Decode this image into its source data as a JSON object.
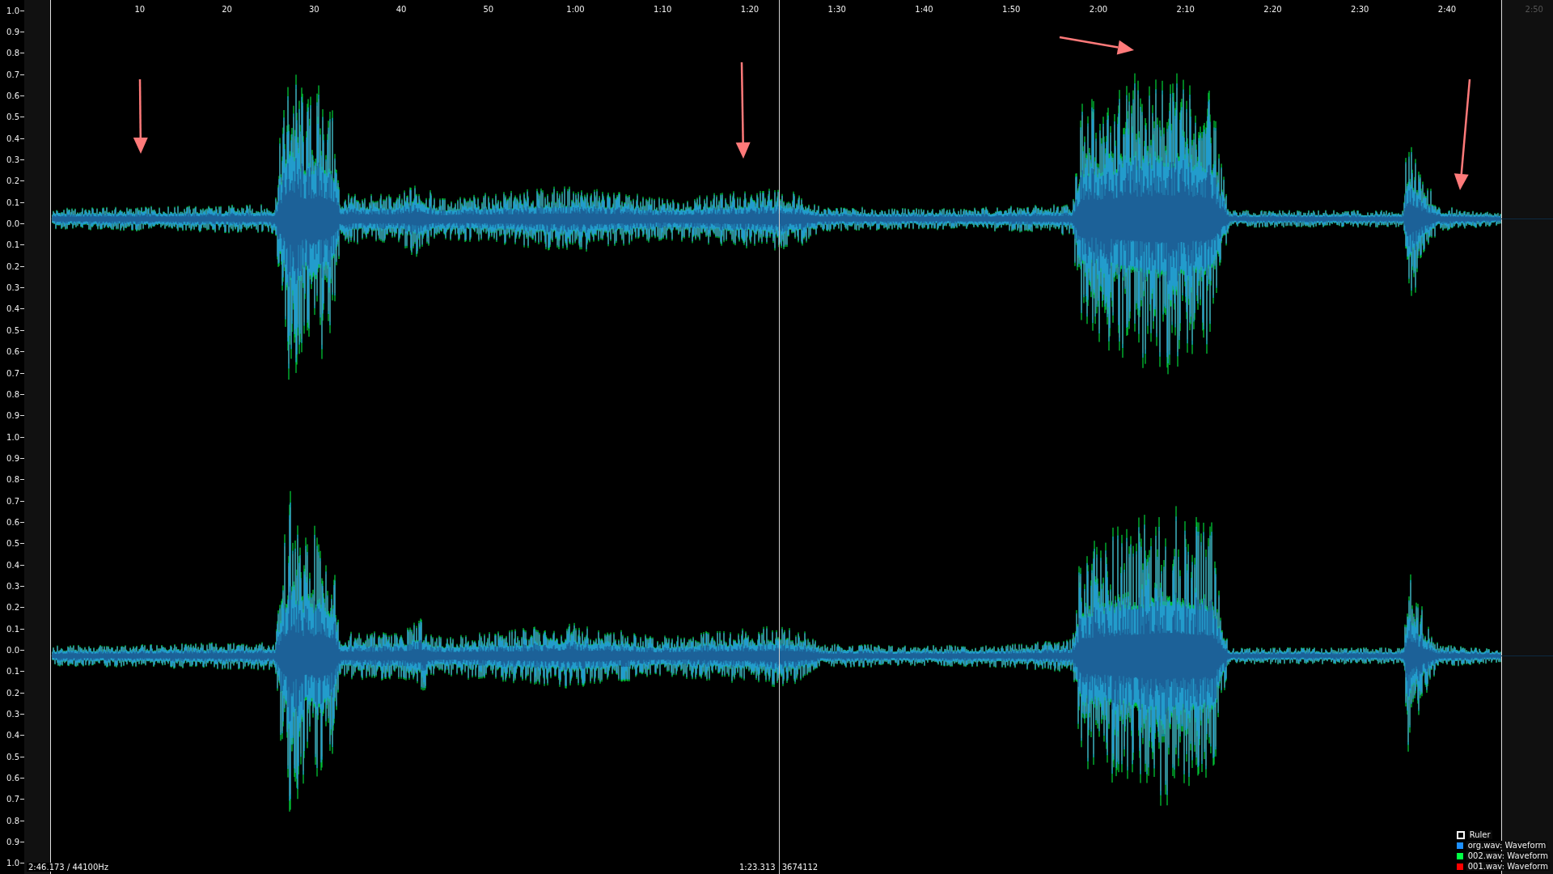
{
  "amplitude_axis": {
    "labels": [
      "1.0",
      "0.9",
      "0.8",
      "0.7",
      "0.6",
      "0.5",
      "0.4",
      "0.3",
      "0.2",
      "0.1",
      "0.0",
      "0.1",
      "0.2",
      "0.3",
      "0.4",
      "0.5",
      "0.6",
      "0.7",
      "0.8",
      "0.9",
      "1.0",
      "0.9",
      "0.8",
      "0.7",
      "0.6",
      "0.5",
      "0.4",
      "0.3",
      "0.2",
      "0.1",
      "0.0",
      "0.1",
      "0.2",
      "0.3",
      "0.4",
      "0.5",
      "0.6",
      "0.7",
      "0.8",
      "0.9",
      "1.0"
    ]
  },
  "ruler": {
    "ticks": [
      {
        "label": "10",
        "dimmed": false
      },
      {
        "label": "20",
        "dimmed": false
      },
      {
        "label": "30",
        "dimmed": false
      },
      {
        "label": "40",
        "dimmed": false
      },
      {
        "label": "50",
        "dimmed": false
      },
      {
        "label": "1:00",
        "dimmed": false
      },
      {
        "label": "1:10",
        "dimmed": false
      },
      {
        "label": "1:20",
        "dimmed": false
      },
      {
        "label": "1:30",
        "dimmed": false
      },
      {
        "label": "1:40",
        "dimmed": false
      },
      {
        "label": "1:50",
        "dimmed": false
      },
      {
        "label": "2:00",
        "dimmed": false
      },
      {
        "label": "2:10",
        "dimmed": false
      },
      {
        "label": "2:20",
        "dimmed": false
      },
      {
        "label": "2:30",
        "dimmed": false
      },
      {
        "label": "2:40",
        "dimmed": false
      },
      {
        "label": "2:50",
        "dimmed": true
      }
    ]
  },
  "status": {
    "duration_rate": "2:46.173 / 44100Hz",
    "cursor_time": "1:23.313",
    "cursor_sample": "3674112"
  },
  "legend": [
    {
      "label": "Ruler",
      "kind": "outline",
      "color": "#ffffff"
    },
    {
      "label": "org.wav: Waveform",
      "kind": "series",
      "color": "#1e90ff"
    },
    {
      "label": "002.wav: Waveform",
      "kind": "series",
      "color": "#00ff44"
    },
    {
      "label": "001.wav: Waveform",
      "kind": "series",
      "color": "#ff0000"
    }
  ]
}
